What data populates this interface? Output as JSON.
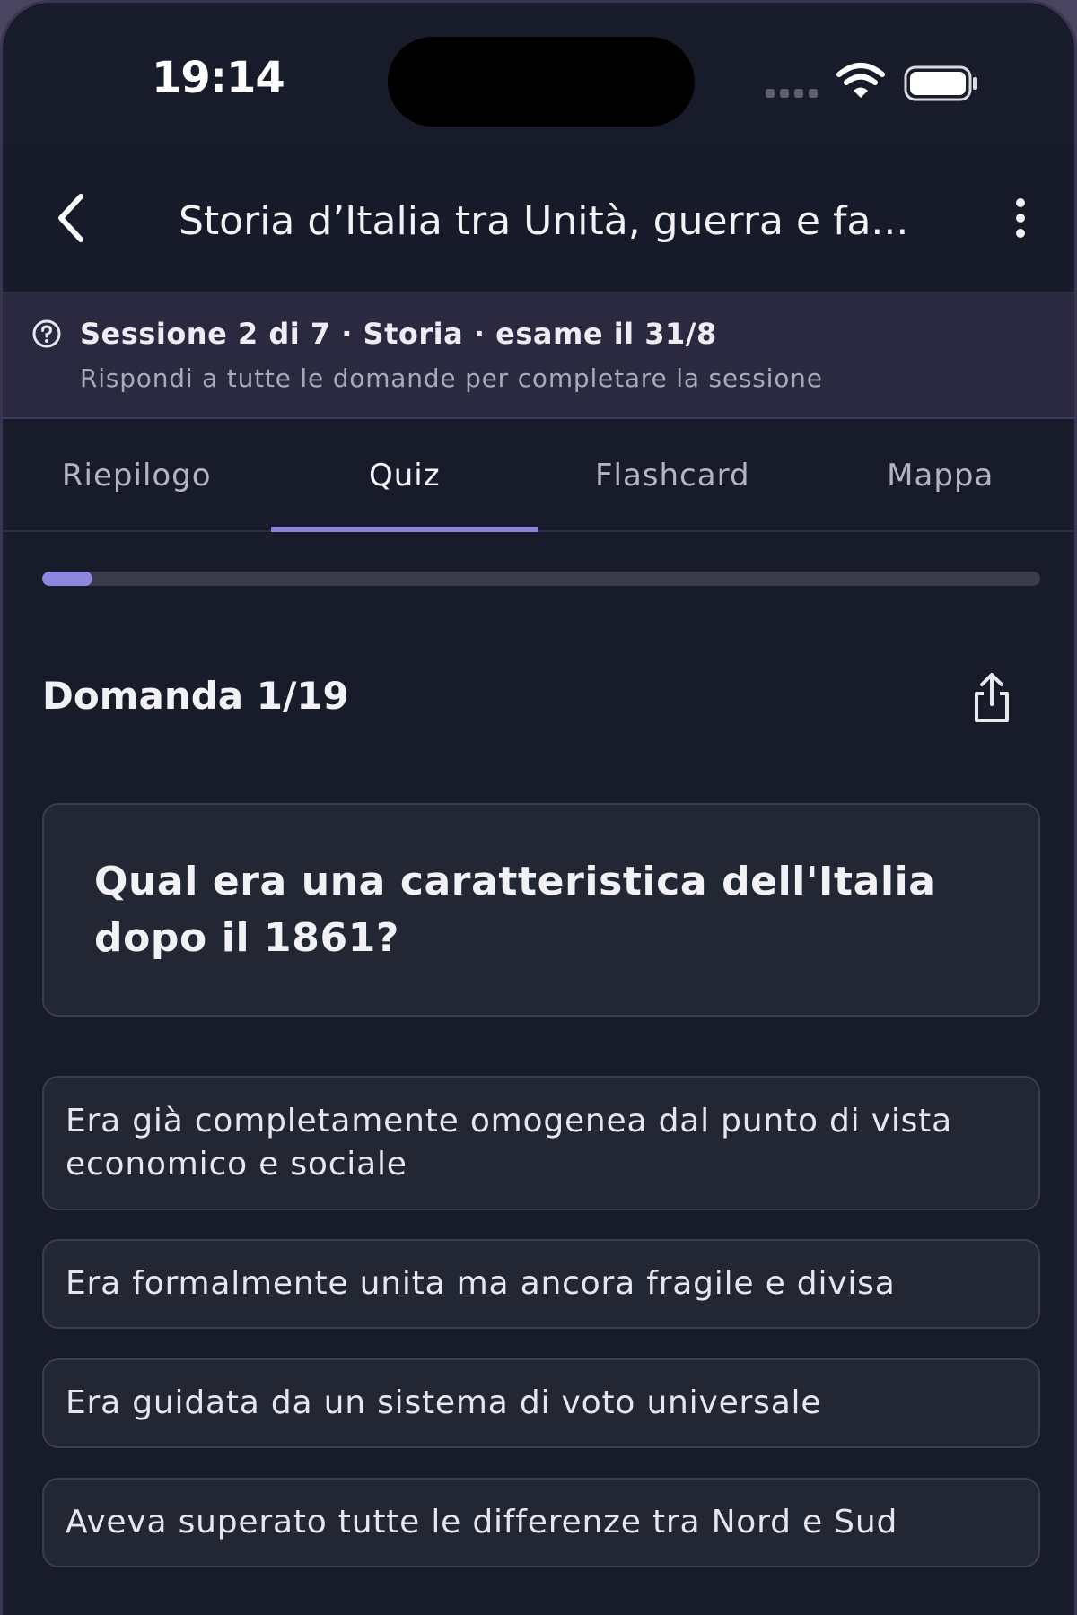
{
  "status_bar": {
    "time": "19:14"
  },
  "header": {
    "title": "Storia d’Italia tra Unità, guerra e fa...",
    "back_icon": "chevron-left-icon",
    "more_icon": "more-vertical-icon"
  },
  "session": {
    "info": "Sessione 2 di 7 · Storia · esame il 31/8",
    "hint": "Rispondi a tutte le domande per completare la sessione",
    "icon": "help-circle-icon"
  },
  "tabs": [
    {
      "label": "Riepilogo",
      "active": false
    },
    {
      "label": "Quiz",
      "active": true
    },
    {
      "label": "Flashcard",
      "active": false
    },
    {
      "label": "Mappa",
      "active": false
    }
  ],
  "quiz": {
    "progress_percent": 5,
    "counter": "Domanda 1/19",
    "share_icon": "share-icon",
    "question": "Qual era una caratteristica dell'Italia dopo il 1861?",
    "answers": [
      "Era già completamente omogenea dal punto di vista economico e sociale",
      "Era formalmente unita ma ancora fragile e divisa",
      "Era guidata da un sistema di voto universale",
      "Aveva superato tutte le differenze tra Nord e Sud"
    ]
  },
  "colors": {
    "background": "#181b29",
    "accent": "#8c82dd",
    "banner": "#2b2940",
    "card": "#232633"
  }
}
